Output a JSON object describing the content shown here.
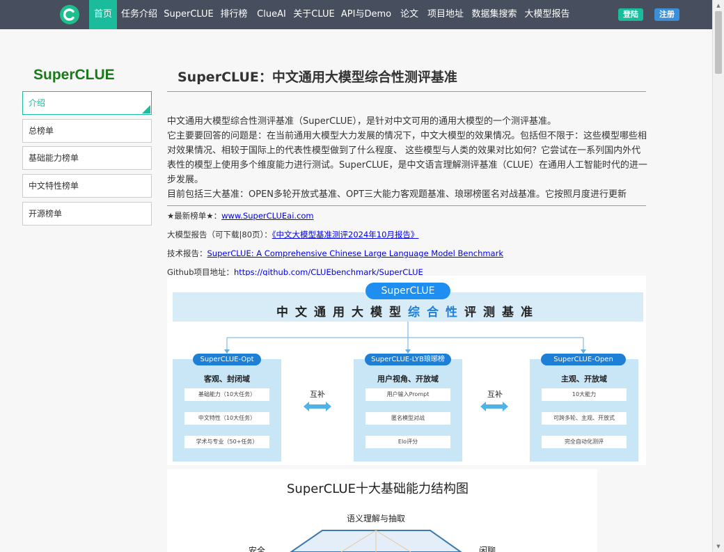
{
  "nav": {
    "items": [
      "首页",
      "任务介绍",
      "SuperCLUE",
      "排行榜",
      "ClueAI",
      "关于CLUE",
      "API与Demo",
      "论文",
      "项目地址",
      "数据集搜索",
      "大模型报告"
    ],
    "login": "登陆",
    "register": "注册"
  },
  "sidebar": {
    "title": "SuperCLUE",
    "items": [
      "介绍",
      "总榜单",
      "基础能力榜单",
      "中文特性榜单",
      "开源榜单"
    ]
  },
  "main": {
    "title": "SuperCLUE：中文通用大模型综合性测评基准",
    "intro": [
      "中文通用大模型综合性测评基准（SuperCLUE），是针对中文可用的通用大模型的一个测评基准。",
      "它主要要回答的问题是：在当前通用大模型大力发展的情况下，中文大模型的效果情况。包括但不限于：这些模型哪些相对效果情况、相较于国际上的代表性模型做到了什么程度、 这些模型与人类的效果对比如何？它尝试在一系列国内外代表性的模型上使用多个维度能力进行测试。SuperCLUE，是中文语言理解测评基准（CLUE）在通用人工智能时代的进一步发展。",
      "目前包括三大基准：OPEN多轮开放式基准、OPT三大能力客观题基准、琅琊榜匿名对战基准。它按照月度进行更新"
    ],
    "links": [
      {
        "label": "★最新榜单★：",
        "text": "www.SuperCLUEai.com"
      },
      {
        "label": "大模型报告（可下载|80页）：",
        "text": "《中文大模型基准测评2024年10月报告》"
      },
      {
        "label": "技术报告：",
        "text": "SuperCLUE: A Comprehensive Chinese Large Language Model Benchmark"
      },
      {
        "label": "Github项目地址：",
        "text": "https://github.com/CLUEbenchmark/SuperCLUE"
      }
    ]
  },
  "diagram": {
    "title": "SuperCLUE",
    "heading_a": "中文通用大模型",
    "heading_hl": "综合性",
    "heading_b": "评测基准",
    "complement": "互补",
    "columns": [
      {
        "name": "SuperCLUE-Opt",
        "sub": "客观、封闭域",
        "rows": [
          "基础能力（10大任务）",
          "中文特性（10大任务）",
          "学术与专业（50+任务）"
        ]
      },
      {
        "name": "SuperCLUE-LYB琅琊榜",
        "sub": "用户视角、开放域",
        "rows": [
          "用户输入Prompt",
          "匿名模型对战",
          "Elo评分"
        ]
      },
      {
        "name": "SuperCLUE-Open",
        "sub": "主观、开放域",
        "rows": [
          "10大能力",
          "可跨多轮、主观、开放式",
          "完全自动化测评"
        ]
      }
    ]
  },
  "card2": {
    "title": "SuperCLUE十大基础能力结构图",
    "labels": [
      "语义理解与抽取",
      "安全",
      "闲聊"
    ]
  },
  "colors": {
    "nav_bg": "#474e5d",
    "accent": "#1abc9c",
    "register": "#3a8fd8",
    "diagram_blue": "#1e7fd6"
  }
}
